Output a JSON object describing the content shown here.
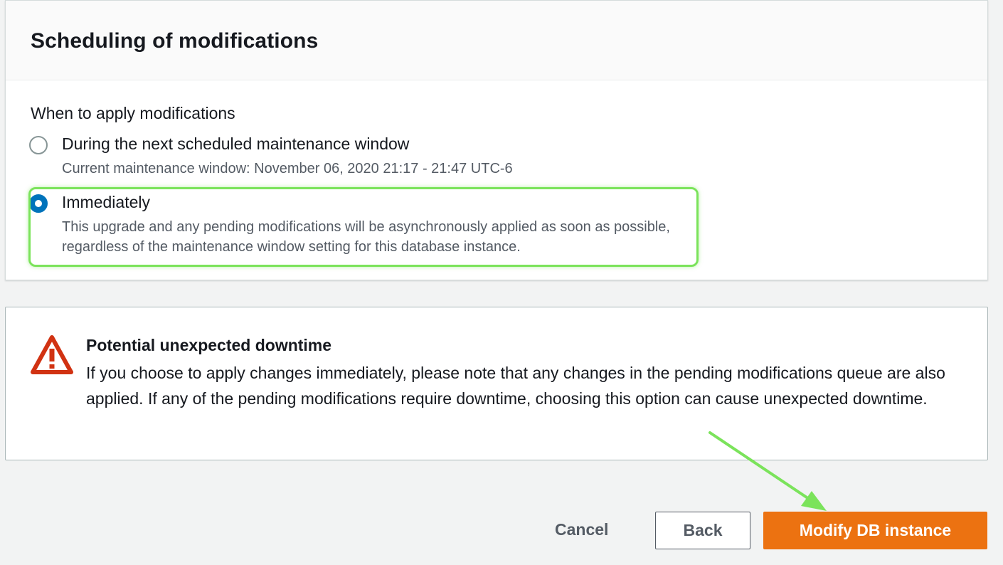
{
  "section": {
    "title": "Scheduling of modifications",
    "field_label": "When to apply modifications",
    "options": [
      {
        "label": "During the next scheduled maintenance window",
        "description": "Current maintenance window: November 06, 2020 21:17 - 21:47 UTC-6",
        "selected": false
      },
      {
        "label": "Immediately",
        "description": "This upgrade and any pending modifications will be asynchronously applied as soon as possible, regardless of the maintenance window setting for this database instance.",
        "selected": true
      }
    ]
  },
  "alert": {
    "icon": "warning-icon",
    "title": "Potential unexpected downtime",
    "body": "If you choose to apply changes immediately, please note that any changes in the pending modifications queue are also applied. If any of the pending modifications require downtime, choosing this option can cause unexpected downtime."
  },
  "actions": {
    "cancel_label": "Cancel",
    "back_label": "Back",
    "primary_label": "Modify DB instance"
  },
  "colors": {
    "accent": "#0073bb",
    "primary_button": "#ec7211",
    "warning": "#d13212",
    "annotation": "#7be35b"
  }
}
